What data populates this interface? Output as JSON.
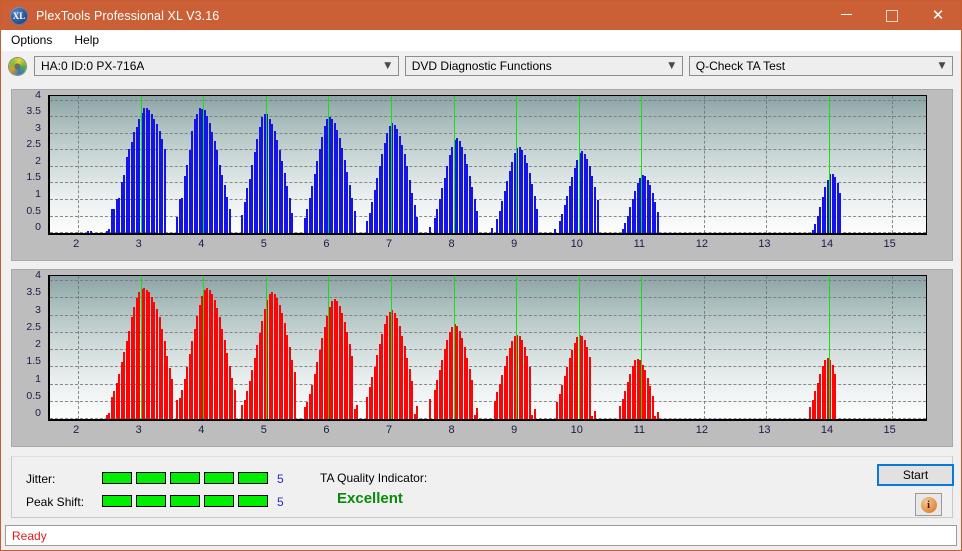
{
  "window": {
    "title": "PlexTools Professional XL V3.16",
    "app_icon": "XL",
    "controls": {
      "minimize": "minimize-icon",
      "maximize": "maximize-icon",
      "close": "close-icon"
    }
  },
  "menu": {
    "items": [
      {
        "label": "Options"
      },
      {
        "label": "Help"
      }
    ]
  },
  "toolbar": {
    "drive_icon": "disc-icon",
    "drive_select": {
      "value": "HA:0 ID:0  PX-716A",
      "arrow": "chevron-down-icon"
    },
    "function_select": {
      "value": "DVD Diagnostic Functions",
      "arrow": "chevron-down-icon"
    },
    "test_select": {
      "value": "Q-Check TA Test",
      "arrow": "chevron-down-icon"
    }
  },
  "bottom": {
    "jitter_label": "Jitter:",
    "jitter_value": "5",
    "jitter_segments": 5,
    "peak_shift_label": "Peak Shift:",
    "peak_shift_value": "5",
    "peak_shift_segments": 5,
    "tqi_label": "TA Quality Indicator:",
    "tqi_value": "Excellent",
    "start_label": "Start",
    "info_glyph": "i",
    "info_icon": "info-icon"
  },
  "status": {
    "text": "Ready"
  },
  "colors": {
    "titlebar": "#cb6036",
    "bar_blue": "#1414e6",
    "bar_red": "#fb0606",
    "marker_green": "#12e112",
    "indicator_green": "#00ef00",
    "tqi_text": "#0a8a0a",
    "status_text": "#e81b1b",
    "focus_blue": "#0a78d7"
  },
  "chart_data": [
    {
      "type": "bar",
      "name": "jitter-chart",
      "series_color": "#1414e6",
      "title": "",
      "xlabel": "",
      "ylabel": "",
      "xlim": [
        1.55,
        15.55
      ],
      "ylim": [
        0,
        4.15
      ],
      "ytick_labels": [
        "0",
        "0.5",
        "1",
        "1.5",
        "2",
        "2.5",
        "3",
        "3.5",
        "4"
      ],
      "ytick_values": [
        0,
        0.5,
        1,
        1.5,
        2,
        2.5,
        3,
        3.5,
        4
      ],
      "xtick_labels": [
        "2",
        "3",
        "4",
        "5",
        "6",
        "7",
        "8",
        "9",
        "10",
        "11",
        "12",
        "13",
        "14",
        "15"
      ],
      "xtick_values": [
        2,
        3,
        4,
        5,
        6,
        7,
        8,
        9,
        10,
        11,
        12,
        13,
        14,
        15
      ],
      "grid": true,
      "markers": [
        3,
        4,
        5,
        6,
        7,
        8,
        9,
        10,
        11,
        14
      ],
      "x": [
        2.15,
        2.2,
        2.46,
        2.5,
        2.54,
        2.58,
        2.62,
        2.66,
        2.7,
        2.74,
        2.78,
        2.82,
        2.86,
        2.9,
        2.94,
        2.98,
        3.02,
        3.06,
        3.1,
        3.14,
        3.18,
        3.22,
        3.26,
        3.3,
        3.34,
        3.38,
        3.58,
        3.62,
        3.66,
        3.7,
        3.74,
        3.78,
        3.82,
        3.86,
        3.9,
        3.94,
        3.98,
        4.02,
        4.06,
        4.1,
        4.14,
        4.18,
        4.22,
        4.26,
        4.3,
        4.34,
        4.38,
        4.42,
        4.62,
        4.66,
        4.7,
        4.74,
        4.78,
        4.82,
        4.86,
        4.9,
        4.94,
        4.98,
        5.02,
        5.06,
        5.1,
        5.14,
        5.18,
        5.22,
        5.26,
        5.3,
        5.34,
        5.38,
        5.42,
        5.62,
        5.66,
        5.7,
        5.74,
        5.78,
        5.82,
        5.86,
        5.9,
        5.94,
        5.98,
        6.02,
        6.06,
        6.1,
        6.14,
        6.18,
        6.22,
        6.26,
        6.3,
        6.34,
        6.38,
        6.42,
        6.62,
        6.66,
        6.7,
        6.74,
        6.78,
        6.82,
        6.86,
        6.9,
        6.94,
        6.98,
        7.02,
        7.06,
        7.1,
        7.14,
        7.18,
        7.22,
        7.26,
        7.3,
        7.34,
        7.38,
        7.42,
        7.62,
        7.7,
        7.74,
        7.78,
        7.82,
        7.86,
        7.9,
        7.94,
        7.98,
        8.02,
        8.06,
        8.1,
        8.14,
        8.18,
        8.22,
        8.26,
        8.3,
        8.34,
        8.38,
        8.62,
        8.7,
        8.74,
        8.78,
        8.82,
        8.86,
        8.9,
        8.94,
        8.98,
        9.02,
        9.06,
        9.1,
        9.14,
        9.18,
        9.22,
        9.26,
        9.3,
        9.34,
        9.62,
        9.7,
        9.74,
        9.78,
        9.82,
        9.86,
        9.9,
        9.94,
        9.98,
        10.02,
        10.06,
        10.1,
        10.14,
        10.18,
        10.22,
        10.26,
        10.3,
        10.7,
        10.74,
        10.78,
        10.82,
        10.86,
        10.9,
        10.94,
        10.98,
        11.02,
        11.06,
        11.1,
        11.14,
        11.18,
        11.22,
        11.26,
        13.74,
        13.78,
        13.82,
        13.86,
        13.9,
        13.94,
        13.98,
        14.02,
        14.06,
        14.1,
        14.14,
        14.18
      ],
      "y": [
        0.06,
        0.06,
        0.05,
        0.12,
        0.72,
        0.72,
        1.02,
        1.05,
        1.55,
        1.75,
        2.3,
        2.55,
        2.75,
        3.05,
        3.22,
        3.45,
        3.65,
        3.78,
        3.78,
        3.72,
        3.62,
        3.45,
        3.3,
        3.1,
        2.85,
        2.55,
        0.5,
        1.02,
        1.05,
        1.72,
        2.05,
        2.52,
        3.1,
        3.45,
        3.62,
        3.78,
        3.75,
        3.72,
        3.55,
        3.32,
        3.05,
        2.8,
        2.52,
        2.05,
        1.75,
        1.45,
        1.1,
        0.72,
        0.55,
        0.95,
        1.35,
        1.65,
        2.05,
        2.45,
        2.85,
        3.2,
        3.52,
        3.62,
        3.6,
        3.45,
        3.3,
        3.08,
        2.82,
        2.52,
        2.18,
        1.82,
        1.42,
        1.05,
        0.62,
        0.45,
        0.72,
        1.05,
        1.42,
        1.8,
        2.18,
        2.55,
        2.92,
        3.25,
        3.45,
        3.5,
        3.45,
        3.32,
        3.12,
        2.88,
        2.58,
        2.22,
        1.85,
        1.45,
        1.05,
        0.68,
        0.35,
        0.62,
        0.95,
        1.3,
        1.68,
        2.02,
        2.38,
        2.72,
        3.02,
        3.25,
        3.32,
        3.28,
        3.15,
        2.95,
        2.68,
        2.38,
        2.02,
        1.62,
        1.22,
        0.85,
        0.5,
        0.18,
        0.45,
        0.72,
        1.02,
        1.35,
        1.68,
        2.02,
        2.35,
        2.62,
        2.82,
        2.88,
        2.8,
        2.62,
        2.38,
        2.08,
        1.72,
        1.38,
        1.02,
        0.68,
        0.15,
        0.42,
        0.68,
        0.98,
        1.28,
        1.58,
        1.88,
        2.15,
        2.42,
        2.58,
        2.62,
        2.52,
        2.35,
        2.12,
        1.82,
        1.48,
        1.12,
        0.72,
        0.12,
        0.35,
        0.58,
        0.85,
        1.12,
        1.42,
        1.7,
        1.98,
        2.22,
        2.42,
        2.48,
        2.4,
        2.25,
        2.02,
        1.72,
        1.38,
        1.0,
        0.12,
        0.3,
        0.52,
        0.78,
        1.02,
        1.28,
        1.52,
        1.68,
        1.75,
        1.72,
        1.62,
        1.45,
        1.22,
        0.95,
        0.65,
        0.1,
        0.28,
        0.52,
        0.8,
        1.08,
        1.38,
        1.62,
        1.78,
        1.8,
        1.7,
        1.5,
        1.22
      ]
    },
    {
      "type": "bar",
      "name": "peak-shift-chart",
      "series_color": "#fb0606",
      "title": "",
      "xlabel": "",
      "ylabel": "",
      "xlim": [
        1.55,
        15.55
      ],
      "ylim": [
        0,
        4.15
      ],
      "ytick_labels": [
        "0",
        "0.5",
        "1",
        "1.5",
        "2",
        "2.5",
        "3",
        "3.5",
        "4"
      ],
      "ytick_values": [
        0,
        0.5,
        1,
        1.5,
        2,
        2.5,
        3,
        3.5,
        4
      ],
      "xtick_labels": [
        "2",
        "3",
        "4",
        "5",
        "6",
        "7",
        "8",
        "9",
        "10",
        "11",
        "12",
        "13",
        "14",
        "15"
      ],
      "xtick_values": [
        2,
        3,
        4,
        5,
        6,
        7,
        8,
        9,
        10,
        11,
        12,
        13,
        14,
        15
      ],
      "grid": true,
      "markers": [
        3,
        4,
        5,
        6,
        7,
        8,
        9,
        10,
        11,
        14
      ],
      "x": [
        2.46,
        2.5,
        2.54,
        2.58,
        2.62,
        2.66,
        2.7,
        2.74,
        2.78,
        2.82,
        2.86,
        2.9,
        2.94,
        2.98,
        3.02,
        3.06,
        3.1,
        3.14,
        3.18,
        3.22,
        3.26,
        3.3,
        3.34,
        3.38,
        3.42,
        3.46,
        3.5,
        3.58,
        3.62,
        3.66,
        3.7,
        3.74,
        3.78,
        3.82,
        3.86,
        3.9,
        3.94,
        3.98,
        4.02,
        4.06,
        4.1,
        4.14,
        4.18,
        4.22,
        4.26,
        4.3,
        4.34,
        4.38,
        4.42,
        4.46,
        4.5,
        4.62,
        4.66,
        4.7,
        4.74,
        4.78,
        4.82,
        4.86,
        4.9,
        4.94,
        4.98,
        5.02,
        5.06,
        5.1,
        5.14,
        5.18,
        5.22,
        5.26,
        5.3,
        5.34,
        5.38,
        5.42,
        5.46,
        5.62,
        5.66,
        5.7,
        5.74,
        5.78,
        5.82,
        5.86,
        5.9,
        5.94,
        5.98,
        6.02,
        6.06,
        6.1,
        6.14,
        6.18,
        6.22,
        6.26,
        6.3,
        6.34,
        6.38,
        6.42,
        6.46,
        6.62,
        6.66,
        6.7,
        6.74,
        6.78,
        6.82,
        6.86,
        6.9,
        6.94,
        6.98,
        7.02,
        7.06,
        7.1,
        7.14,
        7.18,
        7.22,
        7.26,
        7.3,
        7.34,
        7.38,
        7.42,
        7.62,
        7.7,
        7.74,
        7.78,
        7.82,
        7.86,
        7.9,
        7.94,
        7.98,
        8.02,
        8.06,
        8.1,
        8.14,
        8.18,
        8.22,
        8.26,
        8.3,
        8.34,
        8.38,
        8.66,
        8.7,
        8.74,
        8.78,
        8.82,
        8.86,
        8.9,
        8.94,
        8.98,
        9.02,
        9.06,
        9.1,
        9.14,
        9.18,
        9.22,
        9.26,
        9.3,
        9.66,
        9.7,
        9.74,
        9.78,
        9.82,
        9.86,
        9.9,
        9.94,
        9.98,
        10.02,
        10.06,
        10.1,
        10.14,
        10.18,
        10.22,
        10.26,
        10.66,
        10.7,
        10.74,
        10.78,
        10.82,
        10.86,
        10.9,
        10.94,
        10.98,
        11.02,
        11.06,
        11.1,
        11.14,
        11.18,
        11.22,
        11.26,
        13.7,
        13.74,
        13.78,
        13.82,
        13.86,
        13.9,
        13.94,
        13.98,
        14.02,
        14.06,
        14.1,
        14.14,
        14.18
      ],
      "y": [
        0.12,
        0.18,
        0.65,
        0.8,
        1.05,
        1.3,
        1.65,
        1.95,
        2.25,
        2.55,
        2.95,
        3.25,
        3.5,
        3.7,
        3.78,
        3.8,
        3.75,
        3.68,
        3.55,
        3.4,
        3.2,
        2.95,
        2.62,
        2.25,
        1.82,
        1.48,
        1.15,
        0.55,
        0.62,
        0.85,
        1.15,
        1.5,
        1.88,
        2.25,
        2.62,
        2.98,
        3.32,
        3.58,
        3.75,
        3.8,
        3.75,
        3.62,
        3.45,
        3.22,
        2.95,
        2.62,
        2.28,
        1.92,
        1.55,
        1.18,
        0.85,
        0.42,
        0.55,
        0.8,
        1.1,
        1.42,
        1.78,
        2.15,
        2.5,
        2.85,
        3.18,
        3.45,
        3.62,
        3.68,
        3.62,
        3.5,
        3.32,
        3.08,
        2.78,
        2.45,
        2.1,
        1.72,
        1.35,
        0.35,
        0.48,
        0.72,
        1.0,
        1.32,
        1.65,
        2.0,
        2.35,
        2.68,
        2.98,
        3.25,
        3.42,
        3.48,
        3.42,
        3.28,
        3.08,
        2.82,
        2.52,
        2.18,
        1.82,
        0.3,
        0.42,
        0.65,
        0.92,
        1.22,
        1.52,
        1.85,
        2.18,
        2.48,
        2.75,
        2.98,
        3.12,
        3.15,
        3.08,
        2.92,
        2.7,
        2.42,
        2.12,
        1.78,
        1.45,
        1.1,
        0.15,
        0.38,
        0.58,
        0.85,
        1.12,
        1.42,
        1.72,
        2.02,
        2.28,
        2.52,
        2.68,
        2.75,
        2.7,
        2.55,
        2.35,
        2.08,
        1.78,
        1.45,
        1.12,
        0.12,
        0.32,
        0.52,
        0.78,
        1.02,
        1.28,
        1.55,
        1.82,
        2.05,
        2.25,
        2.4,
        2.45,
        2.4,
        2.28,
        2.08,
        1.82,
        1.52,
        0.12,
        0.28,
        0.48,
        0.72,
        0.98,
        1.25,
        1.52,
        1.78,
        2.0,
        2.22,
        2.38,
        2.45,
        2.4,
        2.28,
        2.08,
        1.8,
        0.1,
        0.22,
        0.38,
        0.58,
        0.82,
        1.08,
        1.32,
        1.55,
        1.7,
        1.75,
        1.7,
        1.58,
        1.42,
        1.2,
        0.95,
        0.68,
        0.1,
        0.2,
        0.35,
        0.55,
        0.8,
        1.05,
        1.32,
        1.55,
        1.72,
        1.78,
        1.72,
        1.58,
        1.32
      ]
    }
  ]
}
